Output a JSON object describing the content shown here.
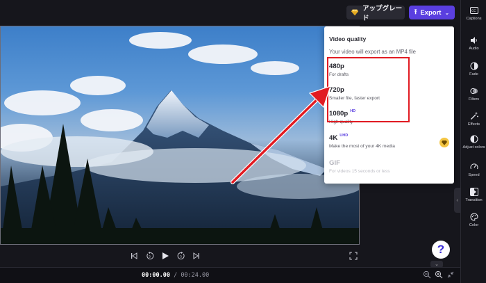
{
  "header": {
    "upgrade_label": "アップグレード",
    "export_label": "Export"
  },
  "player": {
    "current_time": "00:00.00",
    "separator": " / ",
    "total_time": "00:24.00"
  },
  "help": {
    "label": "?"
  },
  "sidebar": {
    "items": [
      {
        "label": "Captions",
        "icon": "captions-icon"
      },
      {
        "label": "Audio",
        "icon": "speaker-icon"
      },
      {
        "label": "Fade",
        "icon": "fade-icon"
      },
      {
        "label": "Filters",
        "icon": "filters-icon"
      },
      {
        "label": "Effects",
        "icon": "magic-wand-icon"
      },
      {
        "label": "Adjust colors",
        "icon": "contrast-icon"
      },
      {
        "label": "Speed",
        "icon": "speedometer-icon"
      },
      {
        "label": "Transition",
        "icon": "transition-icon"
      },
      {
        "label": "Color",
        "icon": "palette-icon"
      }
    ]
  },
  "export_menu": {
    "title": "Video quality",
    "subtitle": "Your video will export as an MP4 file",
    "options": [
      {
        "name": "480p",
        "badge": "",
        "desc": "For drafts",
        "enabled": true
      },
      {
        "name": "720p",
        "badge": "",
        "desc": "Smaller file, faster export",
        "enabled": true
      },
      {
        "name": "1080p",
        "badge": "HD",
        "desc": "High quality",
        "enabled": true
      },
      {
        "name": "4K",
        "badge": "UHD",
        "desc": "Make the most of your 4K media",
        "enabled": true,
        "premium": true
      },
      {
        "name": "GIF",
        "badge": "",
        "desc": "For videos 15 seconds or less",
        "enabled": false
      }
    ]
  },
  "colors": {
    "accent": "#5a3fe0",
    "annotation": "#e11b22",
    "background": "#16161c"
  }
}
